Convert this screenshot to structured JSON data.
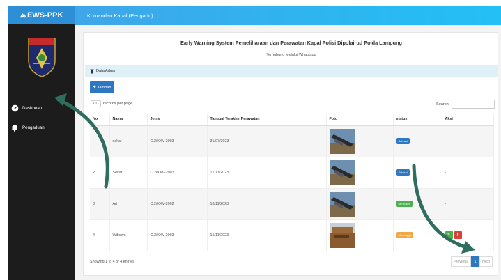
{
  "brand": {
    "name": "EWS-PPK",
    "glyph": "⩕"
  },
  "sidebar": {
    "items": [
      {
        "label": "Dashboard",
        "icon": "dashboard-gauge-icon"
      },
      {
        "label": "Pengaduan",
        "icon": "bell-icon"
      }
    ]
  },
  "topbar": {
    "title": "Komandan Kapal (Pengadu)"
  },
  "page": {
    "title": "Early Warning System Pemeliharaan dan Perawatan Kapal Polisi Dipolairud Polda Lampung",
    "subtitle": "Terhubung Melalui Whatsapp"
  },
  "panel": {
    "label": "Data Aduan",
    "icon": "trash-icon"
  },
  "toolbar": {
    "add_label": "Tambah",
    "add_icon": "plus-icon"
  },
  "length_menu": {
    "value": "10",
    "suffix": "records per page"
  },
  "search": {
    "label": "Search:",
    "value": ""
  },
  "table": {
    "headers": [
      "No",
      "Nama",
      "Jenis",
      "Tanggal Terakhir Perawatan",
      "Foto",
      "status",
      "Aksi"
    ],
    "rows": [
      {
        "no": "",
        "nama": "sekar",
        "jenis": "C.2/XXV-2003",
        "tanggal": "31/07/2023",
        "status": "Selesai",
        "aksi": "-"
      },
      {
        "no": "2",
        "nama": "Sekar",
        "jenis": "C.2/XXV-2003",
        "tanggal": "17/11/2023",
        "status": "Selesai",
        "aksi": "-"
      },
      {
        "no": "3",
        "nama": "Ari",
        "jenis": "C.2/XXV-2002",
        "tanggal": "18/11/2023",
        "status": "Di Proses",
        "aksi": "-"
      },
      {
        "no": "4",
        "nama": "Wibowo",
        "jenis": "C.2/XXV-2003",
        "tanggal": "15/11/2023",
        "status": "Menunggu",
        "aksi": ""
      }
    ]
  },
  "footer": {
    "info": "Showing 1 to 4 of 4 entries",
    "prev": "Previous",
    "page": "1",
    "next": "Next"
  },
  "colors": {
    "selesai": "#2e78c2",
    "di_proses": "#4bae4f",
    "menunggu": "#f0a844",
    "edit": "#4bae4f",
    "delete": "#d9413a",
    "arrow": "#2f6e5e"
  }
}
